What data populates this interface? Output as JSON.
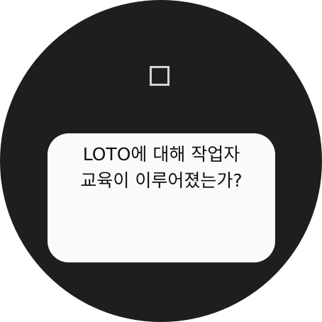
{
  "checklist": {
    "checkbox": {
      "checked": false,
      "icon": "checkbox-unchecked-icon"
    },
    "question": "LOTO에 대해 작업자\n교육이 이루어졌는가?"
  },
  "colors": {
    "face_background": "#1e1e1e",
    "card_background": "#fafafa",
    "checkbox_border": "#d4d4d4",
    "text": "#111111"
  }
}
